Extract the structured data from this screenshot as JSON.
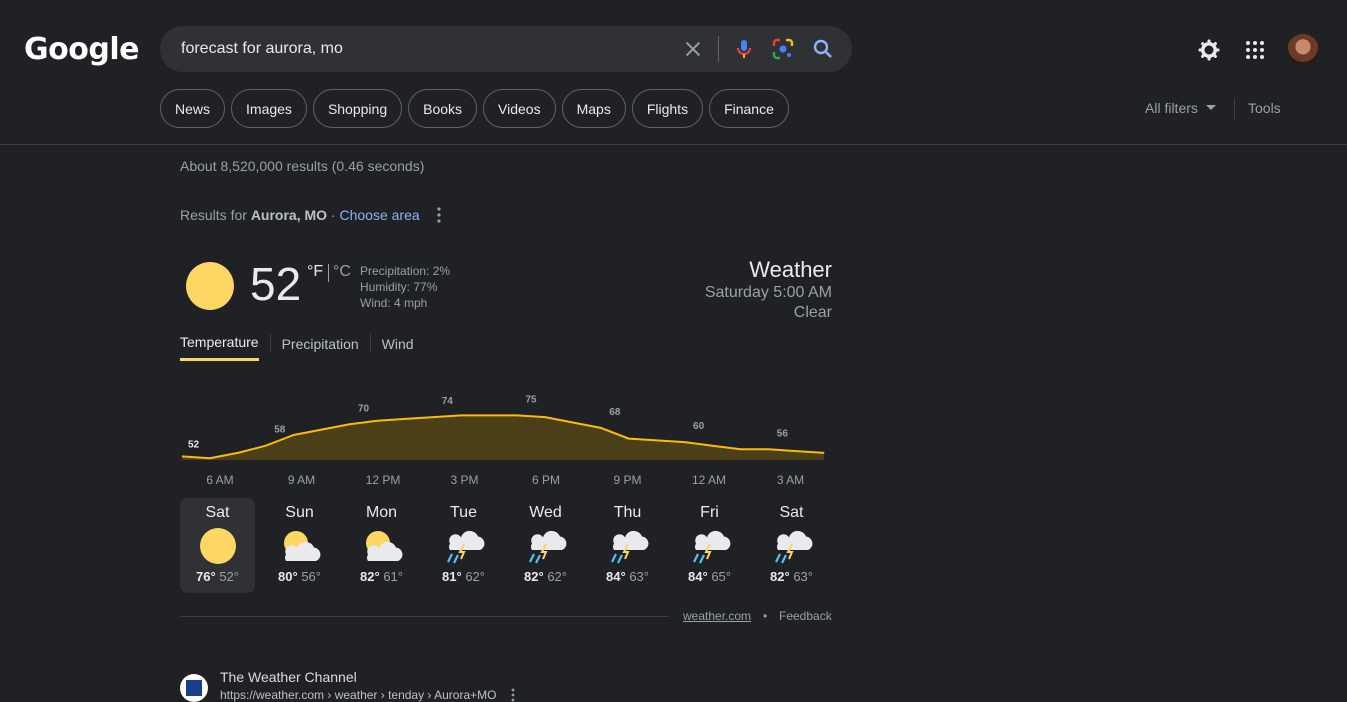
{
  "header": {
    "logo": "Google",
    "search_value": "forecast for aurora, mo"
  },
  "chips": [
    "News",
    "Images",
    "Shopping",
    "Books",
    "Videos",
    "Maps",
    "Flights",
    "Finance"
  ],
  "filters": {
    "all_filters": "All filters",
    "tools": "Tools"
  },
  "stats": "About 8,520,000 results (0.46 seconds)",
  "results_for": {
    "prefix": "Results for ",
    "place": "Aurora, MO",
    "sep": " · ",
    "choose": "Choose area"
  },
  "weather": {
    "temp": "52",
    "unit_f": "°F",
    "unit_c": "°C",
    "precipitation": "Precipitation: 2%",
    "humidity": "Humidity: 77%",
    "wind": "Wind: 4 mph",
    "title": "Weather",
    "time": "Saturday 5:00 AM",
    "condition": "Clear",
    "tabs": [
      "Temperature",
      "Precipitation",
      "Wind"
    ]
  },
  "chart_data": {
    "type": "area",
    "x": [
      "6 AM",
      "7 AM",
      "8 AM",
      "9 AM",
      "10 AM",
      "11 AM",
      "12 PM",
      "1 PM",
      "2 PM",
      "3 PM",
      "4 PM",
      "5 PM",
      "6 PM",
      "7 PM",
      "8 PM",
      "9 PM",
      "10 PM",
      "11 PM",
      "12 AM",
      "1 AM",
      "2 AM",
      "3 AM",
      "4 AM",
      "5 AM"
    ],
    "values": [
      52,
      51,
      54,
      58,
      64,
      67,
      70,
      72,
      73,
      74,
      75,
      75,
      75,
      74,
      71,
      68,
      62,
      61,
      60,
      58,
      56,
      56,
      55,
      54
    ],
    "labeled_points": [
      {
        "index": 0,
        "label": "52"
      },
      {
        "index": 3,
        "label": "58"
      },
      {
        "index": 6,
        "label": "70"
      },
      {
        "index": 9,
        "label": "74"
      },
      {
        "index": 12,
        "label": "75"
      },
      {
        "index": 15,
        "label": "68"
      },
      {
        "index": 18,
        "label": "60"
      },
      {
        "index": 21,
        "label": "56"
      }
    ],
    "tick_labels": [
      "6 AM",
      "9 AM",
      "12 PM",
      "3 PM",
      "6 PM",
      "9 PM",
      "12 AM",
      "3 AM"
    ],
    "line_color": "#fbbc04",
    "fill_color": "#4a3f17"
  },
  "forecast": [
    {
      "day": "Sat",
      "icon": "sunny",
      "hi": "76°",
      "lo": "52°"
    },
    {
      "day": "Sun",
      "icon": "partly-cloudy",
      "hi": "80°",
      "lo": "56°"
    },
    {
      "day": "Mon",
      "icon": "partly-cloudy",
      "hi": "82°",
      "lo": "61°"
    },
    {
      "day": "Tue",
      "icon": "thunderstorm-rain",
      "hi": "81°",
      "lo": "62°"
    },
    {
      "day": "Wed",
      "icon": "thunderstorm-rain",
      "hi": "82°",
      "lo": "62°"
    },
    {
      "day": "Thu",
      "icon": "thunderstorm-rain",
      "hi": "84°",
      "lo": "63°"
    },
    {
      "day": "Fri",
      "icon": "thunderstorm-rain",
      "hi": "84°",
      "lo": "65°"
    },
    {
      "day": "Sat",
      "icon": "thunderstorm-rain",
      "hi": "82°",
      "lo": "63°"
    }
  ],
  "footer": {
    "source": "weather.com",
    "bullet": "•",
    "feedback": "Feedback"
  },
  "next_result": {
    "site": "The Weather Channel",
    "url": "https://weather.com › weather › tenday › Aurora+MO"
  },
  "colors": {
    "background": "#202124",
    "accent_yellow": "#fdd663",
    "link": "#8ab4f8"
  }
}
